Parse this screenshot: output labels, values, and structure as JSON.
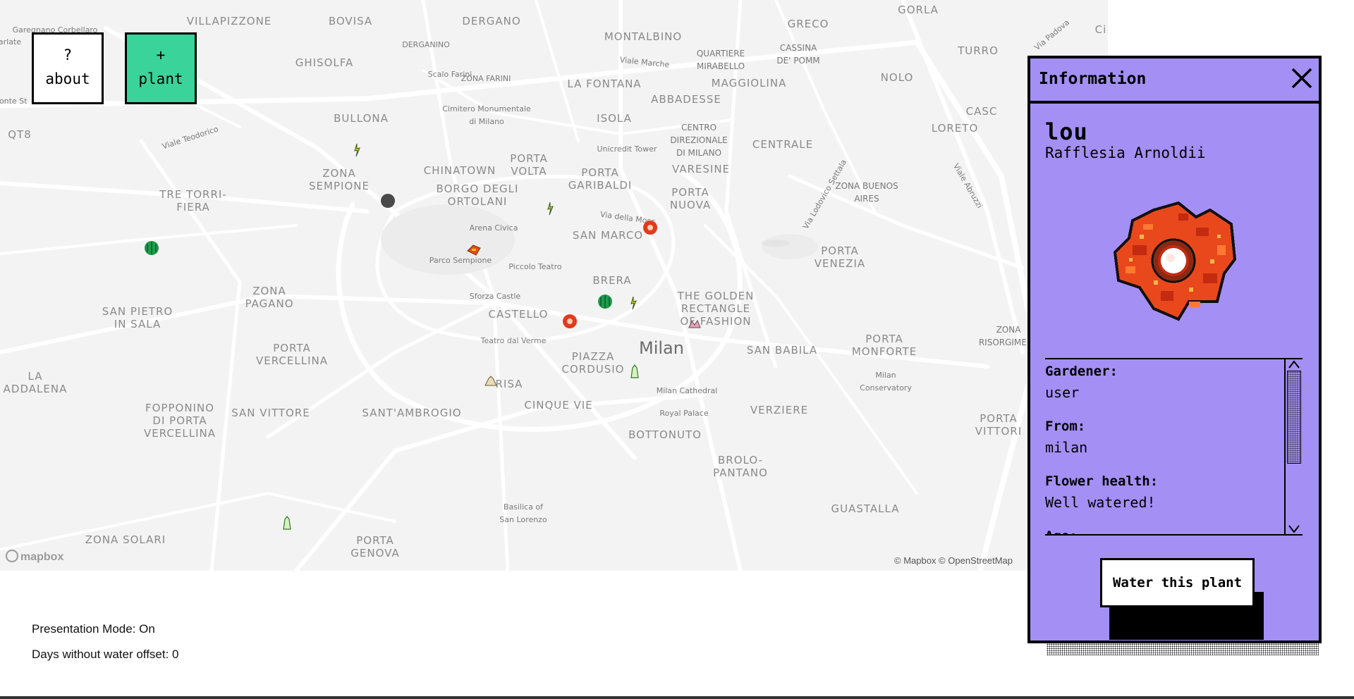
{
  "map": {
    "attribution": "© Mapbox © OpenStreetMap",
    "logo": "mapbox",
    "labels": [
      "VILLAPIZZONE",
      "BOVISA",
      "DERGANO",
      "MONTALBINO",
      "GRECO",
      "GORLA",
      "TURRO",
      "NOLO",
      "GHISOLFA",
      "DERGANINO",
      "ZONA FARINI",
      "LA FONTANA",
      "QUARTIERE\nMIRABELLO",
      "CASSINA\nDE' POMM",
      "MAGGIOLINA",
      "BULLONA",
      "Cimitero Monumentale\ndi Milano",
      "ISOLA",
      "ABBADESSE",
      "CENTRO\nDIREZIONALE\nDI MILANO",
      "CENTRALE",
      "LORETO",
      "ZONA\nSEMPIONE",
      "CHINATOWN",
      "PORTA\nVOLTA",
      "PORTA\nGARIBALDI",
      "Unicredit Tower",
      "VARESINE",
      "PORTA\nNUOVA",
      "ZONA BUENOS\nAIRES",
      "TRE TORRI-\nFIERA",
      "BORGO DEGLI\nORTOLANI",
      "Arena Civica",
      "SAN MARCO",
      "PORTA\nVENEZIA",
      "Parco Sempione",
      "Piccolo Teatro",
      "BRERA",
      "ZONA\nPAGANO",
      "Sforza Castle",
      "CASTELLO",
      "THE GOLDEN\nRECTANGLE\nOF FASHION",
      "SAN PIETRO\nIN SALA",
      "Milan",
      "PORTA\nVERCELLINA",
      "Teatro dal Verme",
      "PIAZZA\nCORDUSIO",
      "SAN BABILA",
      "PORTA\nMONFORTE",
      "ZONA\nRISORGIMENT",
      "LA\nADDALENA",
      "Milan Cathedral",
      "RISA",
      "CINQUE VIE",
      "Milan\nConservatory",
      "VERZIERE",
      "FOPPONINO\nDI PORTA\nVERCELLINA",
      "SAN VITTORE",
      "SANT'AMBROGIO",
      "Royal Palace",
      "BOTTONUTO",
      "PORTA\nVITTORI",
      "BROLO-\nPANTANO",
      "Basilica of\nSan Lorenzo",
      "GUASTALLA",
      "ZONA SOLARI",
      "PORTA\nGENOVA",
      "QT8",
      "Viale Teodorico",
      "Via della Mosc",
      "Viale Marche",
      "Via Padova",
      "Viale Abruzzi",
      "Via Lodovico Settala",
      "Scalo Farini",
      "Garegnano Corbellaro",
      "Ci",
      "CASC",
      "arlate",
      "Monte St"
    ]
  },
  "top_buttons": {
    "about": {
      "icon": "?",
      "label": "about"
    },
    "plant": {
      "icon": "+",
      "label": "plant"
    }
  },
  "panel": {
    "title": "Information",
    "plant_name": "lou",
    "species": "Rafflesia Arnoldii",
    "details": [
      {
        "label": "Gardener:",
        "value": "user"
      },
      {
        "label": "From:",
        "value": "milan"
      },
      {
        "label": "Flower health:",
        "value": "Well watered!"
      },
      {
        "label": "Age:",
        "value": ""
      }
    ],
    "water_button": "Water this plant"
  },
  "status": {
    "presentation_mode": "Presentation Mode: On",
    "days_offset": "Days without water offset: 0"
  },
  "colors": {
    "panel_bg": "#a48ff5",
    "plant_button_bg": "#3ad39a",
    "map_bg": "#f3f3f3"
  }
}
